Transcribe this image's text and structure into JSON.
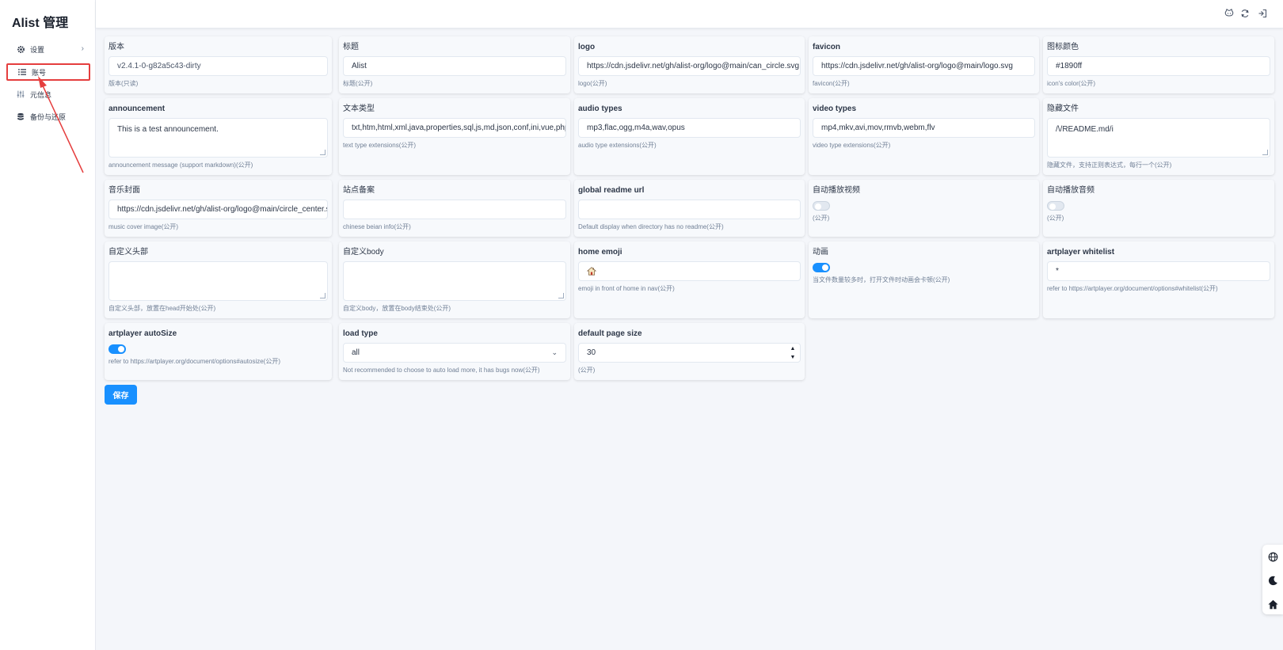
{
  "app": {
    "title": "Alist 管理"
  },
  "sidebar": {
    "items": [
      {
        "label": "设置",
        "icon": "gear-icon"
      },
      {
        "label": "账号",
        "icon": "list-icon"
      },
      {
        "label": "元信息",
        "icon": "sliders-icon"
      },
      {
        "label": "备份与还原",
        "icon": "database-icon"
      }
    ]
  },
  "header": {
    "icons": [
      "github-icon",
      "refresh-icon",
      "logout-icon"
    ]
  },
  "settings": {
    "version": {
      "label": "版本",
      "value": "v2.4.1-0-g82a5c43-dirty",
      "hint": "版本(只读)"
    },
    "title": {
      "label": "标题",
      "value": "Alist",
      "hint": "标题(公开)"
    },
    "logo": {
      "label": "logo",
      "value": "https://cdn.jsdelivr.net/gh/alist-org/logo@main/can_circle.svg",
      "hint": "logo(公开)"
    },
    "favicon": {
      "label": "favicon",
      "value": "https://cdn.jsdelivr.net/gh/alist-org/logo@main/logo.svg",
      "hint": "favicon(公开)"
    },
    "icon_color": {
      "label": "图标颜色",
      "value": "#1890ff",
      "hint": "icon's color(公开)"
    },
    "announcement": {
      "label": "announcement",
      "value": "This is a test announcement.",
      "hint": "announcement message (support markdown)(公开)"
    },
    "text_types": {
      "label": "文本类型",
      "value": "txt,htm,html,xml,java,properties,sql,js,md,json,conf,ini,vue,php",
      "hint": "text type extensions(公开)"
    },
    "audio_types": {
      "label": "audio types",
      "value": "mp3,flac,ogg,m4a,wav,opus",
      "hint": "audio type extensions(公开)"
    },
    "video_types": {
      "label": "video types",
      "value": "mp4,mkv,avi,mov,rmvb,webm,flv",
      "hint": "video type extensions(公开)"
    },
    "hide_files": {
      "label": "隐藏文件",
      "value": "/\\/README.md/i",
      "hint": "隐藏文件，支持正则表达式，每行一个(公开)"
    },
    "music_cover": {
      "label": "音乐封面",
      "value": "https://cdn.jsdelivr.net/gh/alist-org/logo@main/circle_center.svg",
      "hint": "music cover image(公开)"
    },
    "beian": {
      "label": "站点备案",
      "value": "",
      "hint": "chinese beian info(公开)"
    },
    "global_readme_url": {
      "label": "global readme url",
      "value": "",
      "hint": "Default display when directory has no readme(公开)"
    },
    "autoplay_video": {
      "label": "自动播放视频",
      "on": false,
      "hint": "(公开)"
    },
    "autoplay_audio": {
      "label": "自动播放音频",
      "on": false,
      "hint": "(公开)"
    },
    "custom_head": {
      "label": "自定义头部",
      "value": "",
      "hint": "自定义头部，放置在head开始处(公开)"
    },
    "custom_body": {
      "label": "自定义body",
      "value": "",
      "hint": "自定义body，放置在body结束处(公开)"
    },
    "home_emoji": {
      "label": "home emoji",
      "value": "🏠",
      "hint": "emoji in front of home in nav(公开)"
    },
    "animation": {
      "label": "动画",
      "on": true,
      "hint": "当文件数量较多时，打开文件时动画会卡顿(公开)"
    },
    "artplayer_whitelist": {
      "label": "artplayer whitelist",
      "value": "*",
      "hint": "refer to https://artplayer.org/document/options#whitelist(公开)"
    },
    "artplayer_autosize": {
      "label": "artplayer autoSize",
      "on": true,
      "hint": "refer to https://artplayer.org/document/options#autosize(公开)"
    },
    "load_type": {
      "label": "load type",
      "value": "all",
      "hint": "Not recommended to choose to auto load more, it has bugs now(公开)"
    },
    "default_page_size": {
      "label": "default page size",
      "value": "30",
      "hint": "(公开)"
    }
  },
  "actions": {
    "save_label": "保存"
  },
  "float_bar": {
    "icons": [
      "globe-icon",
      "moon-icon",
      "home-icon"
    ]
  },
  "colors": {
    "accent": "#1890ff",
    "highlight": "#e53e3e"
  }
}
